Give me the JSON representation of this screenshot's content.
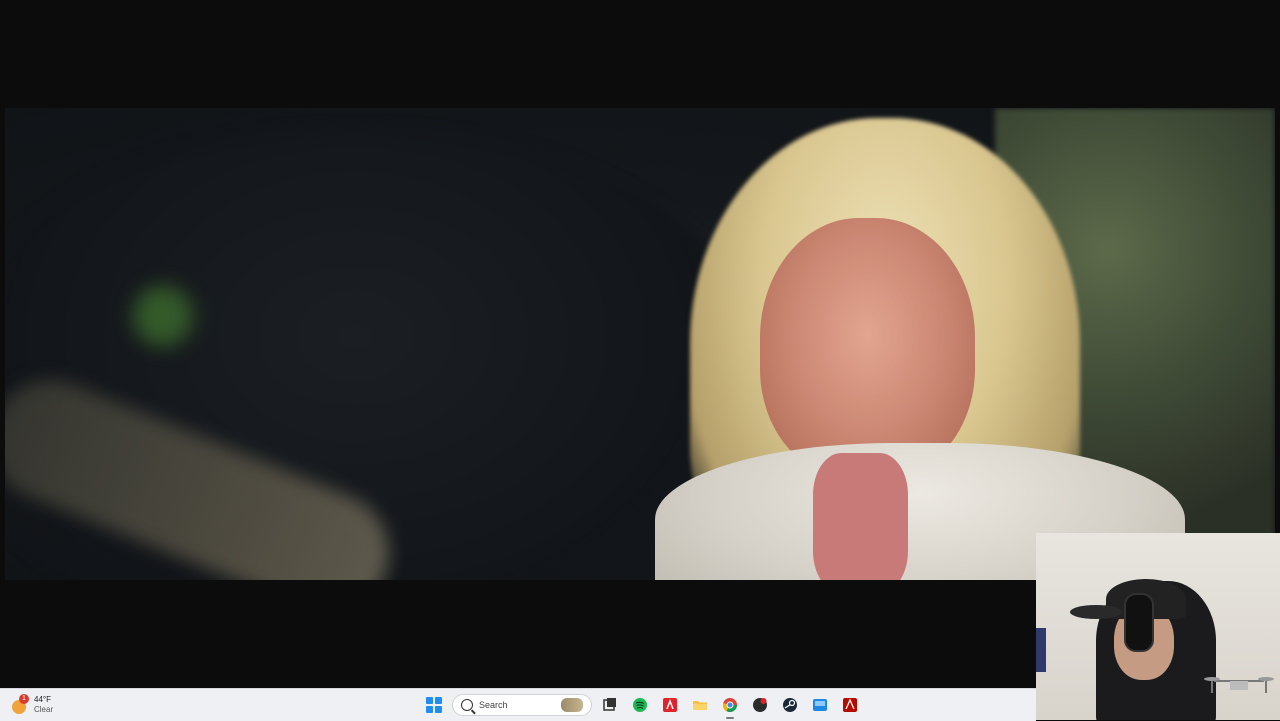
{
  "taskbar": {
    "weather": {
      "badge_count": "1",
      "temperature": "44°F",
      "condition": "Clear"
    },
    "search": {
      "label": "Search"
    },
    "icons": [
      "windows-start-icon",
      "search-icon",
      "task-view-icon",
      "spotify-icon",
      "adobe-icon",
      "file-explorer-icon",
      "chrome-icon",
      "app-icon",
      "steam-icon",
      "app-icon-blue",
      "adobe-acrobat-icon"
    ]
  },
  "colors": {
    "taskbar_bg": "#eef0f3",
    "windows_blue": "#1f8ef1",
    "spotify_green": "#1db954",
    "adobe_red": "#e0222a",
    "explorer_yellow": "#f5c242"
  }
}
